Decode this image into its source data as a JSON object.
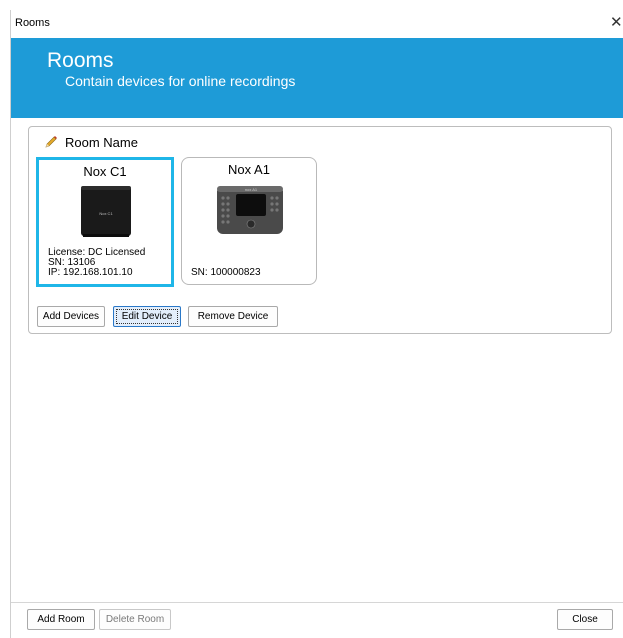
{
  "window": {
    "title": "Rooms",
    "close_glyph": "✕"
  },
  "header": {
    "title": "Rooms",
    "subtitle": "Contain devices for online recordings",
    "background": "#1e9bd7"
  },
  "room": {
    "name": "Room Name",
    "devices": [
      {
        "name": "Nox C1",
        "selected": true,
        "license": "License: DC Licensed",
        "sn": "SN: 13106",
        "ip": "IP: 192.168.101.10",
        "device_label": "Nox C1"
      },
      {
        "name": "Nox A1",
        "selected": false,
        "sn": "SN: 100000823",
        "device_label": "nox A1"
      }
    ],
    "buttons": {
      "add_devices": "Add Devices",
      "edit_device": "Edit Device",
      "remove_device": "Remove Device"
    }
  },
  "footer": {
    "add_room": "Add Room",
    "delete_room": "Delete Room",
    "close": "Close"
  },
  "colors": {
    "accent": "#1e9bd7",
    "selection": "#1fb6e8"
  }
}
